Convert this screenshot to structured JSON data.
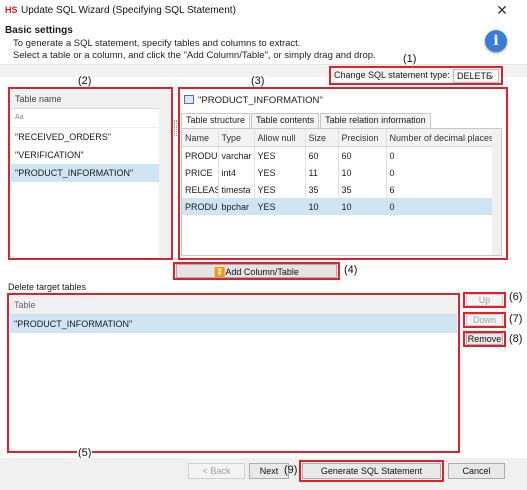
{
  "window": {
    "app_icon": "HS",
    "title": "Update SQL Wizard (Specifying SQL Statement)",
    "close_glyph": "✕"
  },
  "header": {
    "title": "Basic settings",
    "line1": "To generate a SQL statement, specify tables and columns to extract.",
    "line2": "Select a table or a column, and click the \"Add Column/Table\", or simply drag and drop.",
    "info_glyph": "i"
  },
  "sql_type": {
    "label": "Change SQL statement type:",
    "value": "DELETE",
    "arrow": "⌄"
  },
  "table_list": {
    "header": "Table name",
    "filter_placeholder": "Aa",
    "items": [
      "\"RECEIVED_ORDERS\"",
      "\"VERIFICATION\"",
      "\"PRODUCT_INFORMATION\""
    ]
  },
  "detail": {
    "table_title": "\"PRODUCT_INFORMATION\"",
    "tabs": [
      "Table structure",
      "Table contents",
      "Table relation information"
    ],
    "columns": [
      "Name",
      "Type",
      "Allow null",
      "Size",
      "Precision",
      "Number of decimal places"
    ],
    "rows": [
      [
        "PRODUC",
        "varchar",
        "YES",
        "60",
        "60",
        "0"
      ],
      [
        "PRICE",
        "int4",
        "YES",
        "11",
        "10",
        "0"
      ],
      [
        "RELEASE",
        "timesta",
        "YES",
        "35",
        "35",
        "6"
      ],
      [
        "PRODUC",
        "bpchar",
        "YES",
        "10",
        "10",
        "0"
      ]
    ]
  },
  "add_button": {
    "icon": "⏬",
    "label": "Add Column/Table"
  },
  "delete_section": {
    "label": "Delete target tables",
    "header": "Table",
    "items": [
      "\"PRODUCT_INFORMATION\""
    ]
  },
  "side_buttons": {
    "up": "Up",
    "down": "Down",
    "remove": "Remove"
  },
  "footer": {
    "back": "< Back",
    "next": "Next",
    "generate": "Generate SQL Statement",
    "cancel": "Cancel"
  },
  "callouts": [
    "(1)",
    "(2)",
    "(3)",
    "(4)",
    "(5)",
    "(6)",
    "(7)",
    "(8)",
    "(9)"
  ],
  "colors": {
    "annotation_red": "#e0202a",
    "selection": "#cfe5f4",
    "info_blue": "#3a7dd8"
  }
}
